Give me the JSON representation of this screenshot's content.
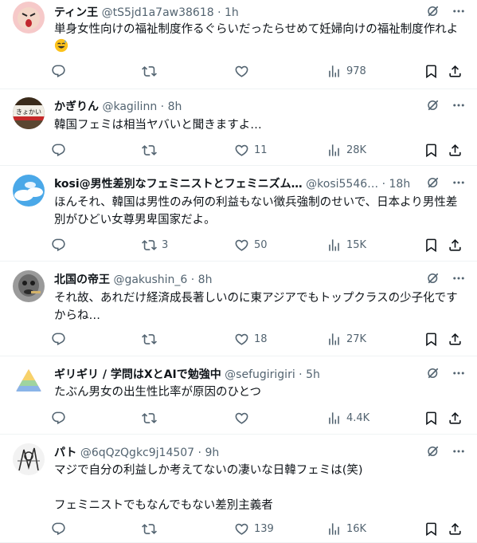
{
  "tweets": [
    {
      "name": "ティン王",
      "handle": "@tS5jd1a7aw38618",
      "time": "1h",
      "text": "単身女性向けの福祉制度作るぐらいだったらせめて妊婦向けの福祉制度作れよ",
      "emoji": "sweat-smile-emoji",
      "replies": "",
      "retweets": "",
      "likes": "",
      "views": "978",
      "avatar": "pink-face"
    },
    {
      "name": "かぎりん",
      "handle": "@kagilinn",
      "time": "8h",
      "text": "韓国フェミは相当ヤバいと聞きますよ…",
      "replies": "",
      "retweets": "",
      "likes": "11",
      "views": "28K",
      "avatar": "sign-photo"
    },
    {
      "name": "kosi@男性差別なフェミニストとフェミニズム…",
      "handle": "@kosi5546…",
      "time": "18h",
      "text": "ほんそれ、韓国は男性のみ何の利益もない徴兵強制のせいで、日本より男性差別がひどい女尊男卑国家だよ。",
      "replies": "",
      "retweets": "3",
      "likes": "50",
      "views": "15K",
      "avatar": "blue-sky"
    },
    {
      "name": "北国の帝王",
      "handle": "@gakushin_6",
      "time": "8h",
      "text": "それ故、あれだけ経済成長著しいのに東アジアでもトップクラスの少子化ですからね…",
      "replies": "",
      "retweets": "",
      "likes": "18",
      "views": "27K",
      "avatar": "gray-face"
    },
    {
      "name": "ギリギリ / 学問はXとAIで勉強中",
      "handle": "@sefugirigiri",
      "time": "5h",
      "text": "たぶん男女の出生性比率が原因のひとつ",
      "replies": "",
      "retweets": "",
      "likes": "",
      "views": "4.4K",
      "avatar": "pyramid"
    },
    {
      "name": "パト",
      "handle": "@6qQzQgkc9j14507",
      "time": "9h",
      "text": "マジで自分の利益しか考えてないの凄いな日韓フェミは(笑)\n\nフェミニストでもなんでもない差別主義者",
      "replies": "",
      "retweets": "",
      "likes": "139",
      "views": "16K",
      "avatar": "sketch"
    }
  ],
  "icons": {
    "reply": "reply-icon",
    "retweet": "retweet-icon",
    "like": "like-icon",
    "views": "views-icon",
    "bookmark": "bookmark-icon",
    "share": "share-icon",
    "grok": "grok-icon",
    "more": "more-icon"
  },
  "colors": {
    "text": "#0f1419",
    "secondary": "#536471",
    "divider": "#eff3f4"
  }
}
